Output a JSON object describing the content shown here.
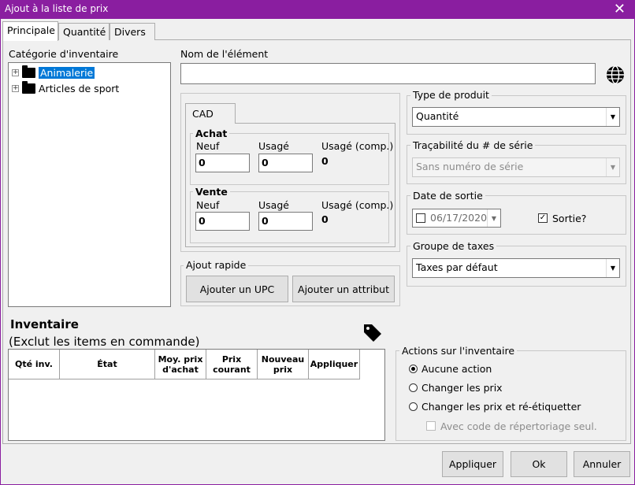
{
  "window": {
    "title": "Ajout à la liste de prix",
    "close": "✕"
  },
  "tabs": [
    {
      "label": "Principale"
    },
    {
      "label": "Quantité"
    },
    {
      "label": "Divers"
    }
  ],
  "inventory_category": {
    "label": "Catégorie d'inventaire",
    "items": [
      {
        "label": "Animalerie"
      },
      {
        "label": "Articles de sport"
      }
    ]
  },
  "item_name": {
    "label": "Nom de l'élément",
    "value": ""
  },
  "currency": {
    "tab": "CAD",
    "purchase": {
      "title": "Achat",
      "new_label": "Neuf",
      "used_label": "Usagé",
      "used_comp_label": "Usagé (comp.)",
      "new_value": "0",
      "used_value": "0",
      "used_comp_value": "0"
    },
    "sale": {
      "title": "Vente",
      "new_label": "Neuf",
      "used_label": "Usagé",
      "used_comp_label": "Usagé (comp.)",
      "new_value": "0",
      "used_value": "0",
      "used_comp_value": "0"
    }
  },
  "quick_add": {
    "title": "Ajout rapide",
    "add_upc": "Ajouter un UPC",
    "add_attribute": "Ajouter un attribut"
  },
  "product_type": {
    "title": "Type de produit",
    "value": "Quantité"
  },
  "serial_tracking": {
    "title": "Traçabilité du # de série",
    "value": "Sans numéro de série"
  },
  "release_date": {
    "title": "Date de sortie",
    "value": "06/17/2020",
    "released_label": "Sortie?"
  },
  "tax_group": {
    "title": "Groupe de taxes",
    "value": "Taxes par défaut"
  },
  "inventory": {
    "title": "Inventaire",
    "subtitle": "(Exclut les items en commande)",
    "columns": [
      "Qté inv.",
      "État",
      "Moy. prix d'achat",
      "Prix courant",
      "Nouveau prix",
      "Appliquer"
    ]
  },
  "inventory_actions": {
    "title": "Actions sur l'inventaire",
    "options": [
      "Aucune action",
      "Changer les prix",
      "Changer les prix et ré-étiquetter"
    ],
    "with_code_label": "Avec code de répertoriage seul."
  },
  "footer": {
    "apply": "Appliquer",
    "ok": "Ok",
    "cancel": "Annuler"
  },
  "colors": {
    "titlebar": "#8a1ea0",
    "selection": "#0078d7"
  }
}
